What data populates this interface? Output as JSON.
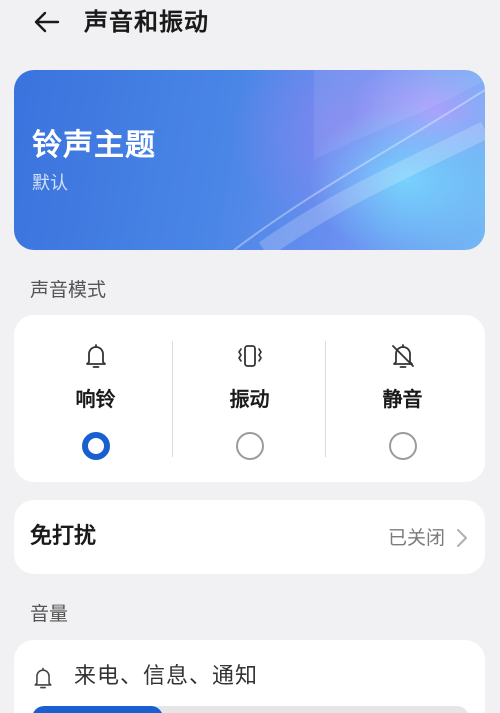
{
  "header": {
    "title": "声音和振动",
    "back_icon": "arrow-left-icon"
  },
  "ringtone_theme": {
    "title": "铃声主题",
    "value": "默认"
  },
  "sound_mode": {
    "section_label": "声音模式",
    "options": [
      {
        "label": "响铃",
        "icon": "bell-icon",
        "selected": true
      },
      {
        "label": "振动",
        "icon": "vibrate-icon",
        "selected": false
      },
      {
        "label": "静音",
        "icon": "bell-off-icon",
        "selected": false
      }
    ]
  },
  "do_not_disturb": {
    "label": "免打扰",
    "value": "已关闭"
  },
  "volume": {
    "section_label": "音量",
    "ring": {
      "label": "来电、信息、通知",
      "icon": "bell-icon",
      "level_fraction": 0.3
    }
  },
  "colors": {
    "accent": "#1a5fd0",
    "background": "#f1f1f3",
    "card": "#ffffff"
  }
}
